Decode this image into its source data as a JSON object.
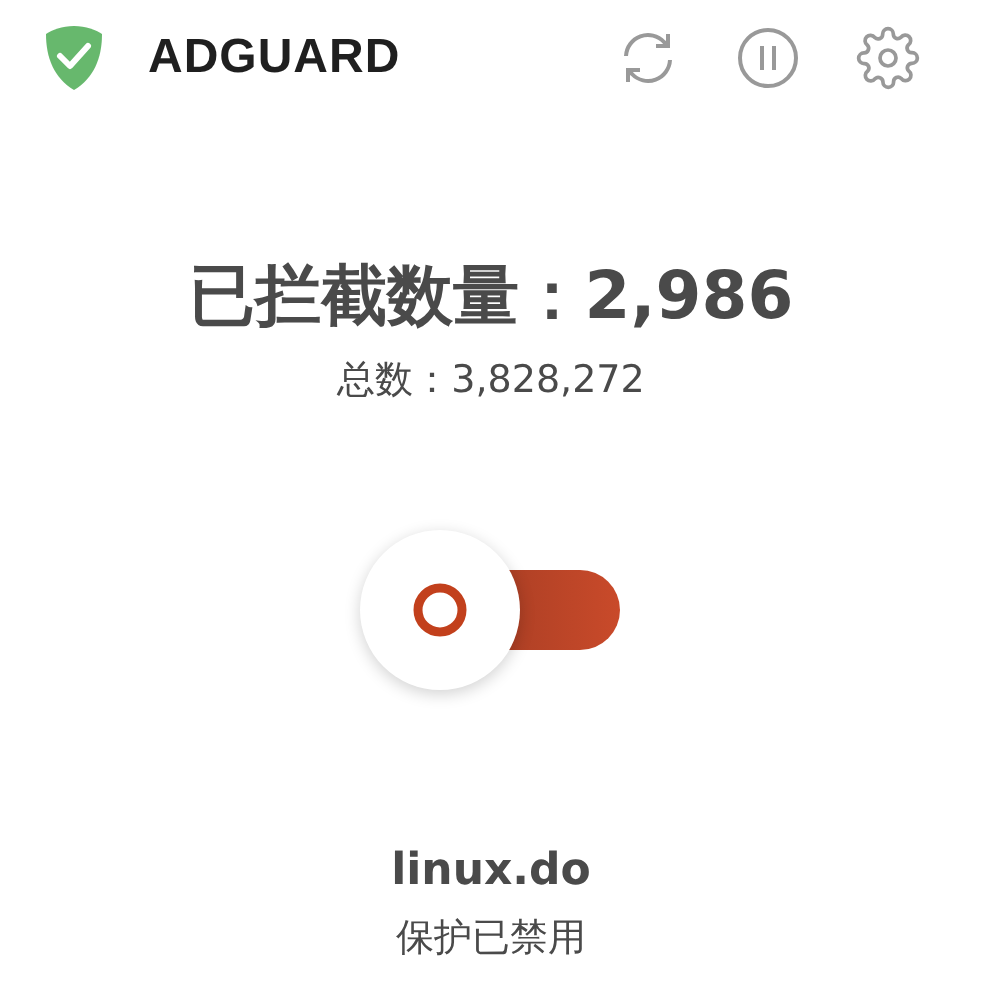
{
  "header": {
    "brand": "ADGUARD"
  },
  "stats": {
    "blocked": "已拦截数量：2,986",
    "total": "总数：3,828,272"
  },
  "protection": {
    "on": false
  },
  "site": {
    "domain": "linux.do",
    "status": "保护已禁用"
  }
}
